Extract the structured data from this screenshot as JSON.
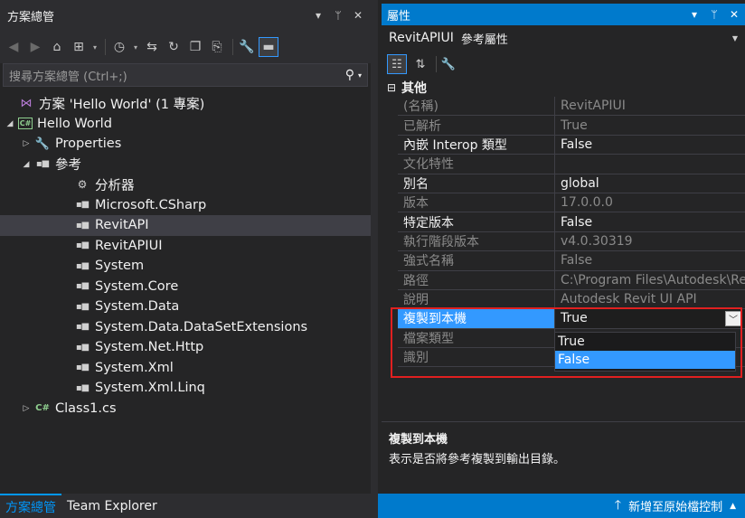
{
  "solution_explorer": {
    "title": "方案總管",
    "title_controls": [
      "▾",
      "ᛘ",
      "✕"
    ],
    "toolbar_icons": [
      "back-icon",
      "forward-icon",
      "home-icon",
      "switch-views-icon",
      "history-icon",
      "sync-icon",
      "refresh-icon",
      "collapse-all-icon",
      "show-all-files-icon",
      "properties-icon",
      "preview-icon"
    ],
    "search": {
      "placeholder": "搜尋方案總管 (Ctrl+;)"
    },
    "tree": [
      {
        "label": "方案 'Hello World' (1 專案)",
        "icon": "solution-icon",
        "level": 0
      },
      {
        "label": "Hello World",
        "icon": "csharp-project-icon",
        "level": 0,
        "expander": "expanded"
      },
      {
        "label": "Properties",
        "icon": "wrench-icon",
        "level": 1,
        "expander": "collapsed"
      },
      {
        "label": "參考",
        "icon": "references-icon",
        "level": 1,
        "expander": "expanded"
      },
      {
        "label": "分析器",
        "icon": "analyzer-icon",
        "level": 2
      },
      {
        "label": "Microsoft.CSharp",
        "icon": "reference-icon",
        "level": 2
      },
      {
        "label": "RevitAPI",
        "icon": "reference-icon",
        "level": 2,
        "selected": true
      },
      {
        "label": "RevitAPIUI",
        "icon": "reference-icon",
        "level": 2
      },
      {
        "label": "System",
        "icon": "reference-icon",
        "level": 2
      },
      {
        "label": "System.Core",
        "icon": "reference-icon",
        "level": 2
      },
      {
        "label": "System.Data",
        "icon": "reference-icon",
        "level": 2
      },
      {
        "label": "System.Data.DataSetExtensions",
        "icon": "reference-icon",
        "level": 2
      },
      {
        "label": "System.Net.Http",
        "icon": "reference-icon",
        "level": 2
      },
      {
        "label": "System.Xml",
        "icon": "reference-icon",
        "level": 2
      },
      {
        "label": "System.Xml.Linq",
        "icon": "reference-icon",
        "level": 2
      },
      {
        "label": "Class1.cs",
        "icon": "csharp-file-icon",
        "level": 1,
        "expander": "collapsed"
      }
    ],
    "bottom_tabs": [
      {
        "label": "方案總管",
        "active": true
      },
      {
        "label": "Team Explorer",
        "active": false
      }
    ]
  },
  "properties": {
    "title": "屬性",
    "title_controls": [
      "▾",
      "ᛘ",
      "✕"
    ],
    "object_name": "RevitAPIUI",
    "object_type": "參考屬性",
    "toolbar_icons": [
      "categorized-icon",
      "alphabetical-icon",
      "property-pages-icon"
    ],
    "category": {
      "expander": "⊟",
      "name": "其他"
    },
    "rows": [
      {
        "name": "(名稱)",
        "value": "RevitAPIUI",
        "readonly": true
      },
      {
        "name": "已解析",
        "value": "True",
        "readonly": true
      },
      {
        "name": "內嵌 Interop 類型",
        "value": "False",
        "readonly": false
      },
      {
        "name": "文化特性",
        "value": "",
        "readonly": true
      },
      {
        "name": "別名",
        "value": "global",
        "readonly": false
      },
      {
        "name": "版本",
        "value": "17.0.0.0",
        "readonly": true
      },
      {
        "name": "特定版本",
        "value": "False",
        "readonly": false
      },
      {
        "name": "執行階段版本",
        "value": "v4.0.30319",
        "readonly": true
      },
      {
        "name": "強式名稱",
        "value": "False",
        "readonly": true
      },
      {
        "name": "路徑",
        "value": "C:\\Program Files\\Autodesk\\Rev",
        "readonly": true
      },
      {
        "name": "說明",
        "value": "Autodesk Revit UI API",
        "readonly": true
      },
      {
        "name": "複製到本機",
        "value": "True",
        "readonly": false,
        "selected": true
      },
      {
        "name": "檔案類型",
        "value": "",
        "readonly": true
      },
      {
        "name": "識別",
        "value": "",
        "readonly": true
      }
    ],
    "dropdown_options": [
      {
        "label": "True",
        "highlighted": false
      },
      {
        "label": "False",
        "highlighted": true
      }
    ],
    "description": {
      "title": "複製到本機",
      "text": "表示是否將參考複製到輸出目錄。"
    }
  },
  "status_bar": {
    "text": "新增至原始檔控制"
  },
  "colors": {
    "accent": "#007acc",
    "selection": "#3399ff",
    "highlight_border": "#e02020"
  }
}
